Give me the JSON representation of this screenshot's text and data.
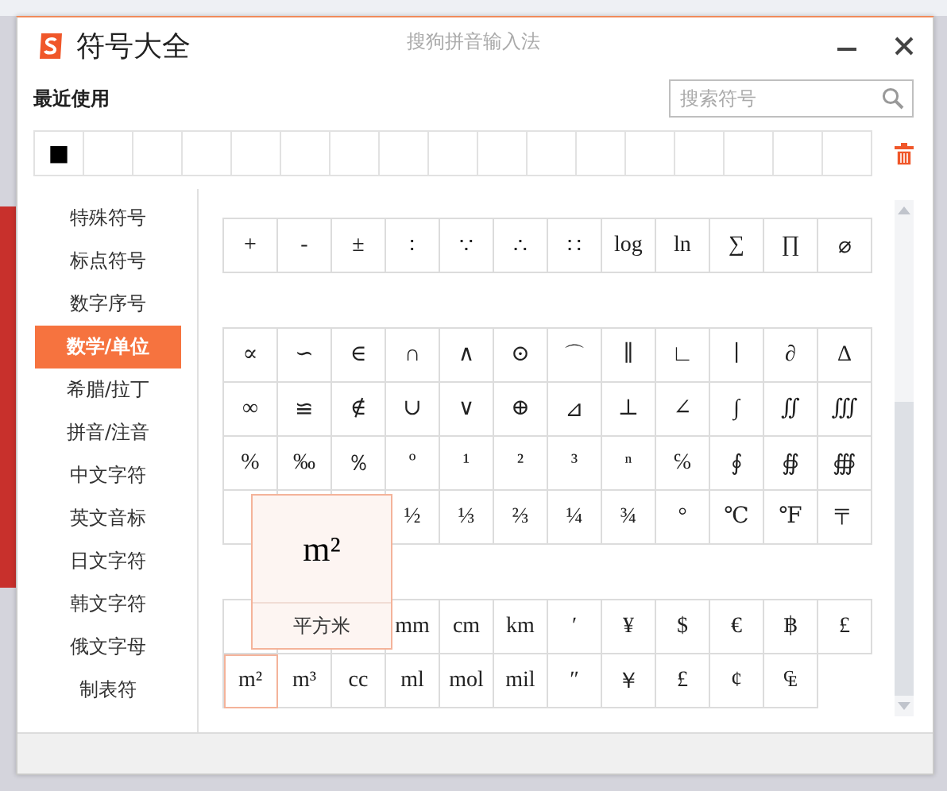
{
  "window": {
    "title": "符号大全",
    "app_name": "搜狗拼音输入法"
  },
  "recent": {
    "label": "最近使用",
    "symbols": [
      "■"
    ]
  },
  "search": {
    "placeholder": "搜索符号"
  },
  "categories": [
    {
      "label": "特殊符号",
      "selected": false
    },
    {
      "label": "标点符号",
      "selected": false
    },
    {
      "label": "数字序号",
      "selected": false
    },
    {
      "label": "数学/单位",
      "selected": true
    },
    {
      "label": "希腊/拉丁",
      "selected": false
    },
    {
      "label": "拼音/注音",
      "selected": false
    },
    {
      "label": "中文字符",
      "selected": false
    },
    {
      "label": "英文音标",
      "selected": false
    },
    {
      "label": "日文字符",
      "selected": false
    },
    {
      "label": "韩文字符",
      "selected": false
    },
    {
      "label": "俄文字母",
      "selected": false
    },
    {
      "label": "制表符",
      "selected": false
    }
  ],
  "sections": [
    {
      "rows": [
        [
          {
            "symbol": "+",
            "selected": false
          },
          {
            "symbol": "-",
            "selected": false
          },
          {
            "symbol": "±",
            "selected": false
          },
          {
            "symbol": "∶",
            "selected": false
          },
          {
            "symbol": "∵",
            "selected": false
          },
          {
            "symbol": "∴",
            "selected": false
          },
          {
            "symbol": "∷",
            "selected": false
          },
          {
            "symbol": "log",
            "selected": false
          },
          {
            "symbol": "ln",
            "selected": false
          },
          {
            "symbol": "∑",
            "selected": false
          },
          {
            "symbol": "∏",
            "selected": false
          },
          {
            "symbol": "⌀",
            "selected": false
          }
        ]
      ]
    },
    {
      "rows": [
        [
          {
            "symbol": "∝",
            "selected": false
          },
          {
            "symbol": "∽",
            "selected": false
          },
          {
            "symbol": "∈",
            "selected": false
          },
          {
            "symbol": "∩",
            "selected": false
          },
          {
            "symbol": "∧",
            "selected": false
          },
          {
            "symbol": "⊙",
            "selected": false
          },
          {
            "symbol": "⌒",
            "selected": false
          },
          {
            "symbol": "∥",
            "selected": false
          },
          {
            "symbol": "∟",
            "selected": false
          },
          {
            "symbol": "∣",
            "selected": false
          },
          {
            "symbol": "∂",
            "selected": false
          },
          {
            "symbol": "Δ",
            "selected": false
          }
        ],
        [
          {
            "symbol": "∞",
            "selected": false
          },
          {
            "symbol": "≌",
            "selected": false
          },
          {
            "symbol": "∉",
            "selected": false
          },
          {
            "symbol": "∪",
            "selected": false
          },
          {
            "symbol": "∨",
            "selected": false
          },
          {
            "symbol": "⊕",
            "selected": false
          },
          {
            "symbol": "⊿",
            "selected": false
          },
          {
            "symbol": "⊥",
            "selected": false
          },
          {
            "symbol": "∠",
            "selected": false
          },
          {
            "symbol": "∫",
            "selected": false
          },
          {
            "symbol": "∬",
            "selected": false
          },
          {
            "symbol": "∭",
            "selected": false
          }
        ],
        [
          {
            "symbol": "%",
            "selected": false
          },
          {
            "symbol": "‰",
            "selected": false
          },
          {
            "symbol": "％",
            "selected": false
          },
          {
            "symbol": "º",
            "selected": false
          },
          {
            "symbol": "¹",
            "selected": false
          },
          {
            "symbol": "²",
            "selected": false
          },
          {
            "symbol": "³",
            "selected": false
          },
          {
            "symbol": "ⁿ",
            "selected": false
          },
          {
            "symbol": "℅",
            "selected": false
          },
          {
            "symbol": "∮",
            "selected": false
          },
          {
            "symbol": "∯",
            "selected": false
          },
          {
            "symbol": "∰",
            "selected": false
          }
        ],
        [
          null,
          null,
          null,
          {
            "symbol": "½",
            "selected": false
          },
          {
            "symbol": "⅓",
            "selected": false
          },
          {
            "symbol": "⅔",
            "selected": false
          },
          {
            "symbol": "¼",
            "selected": false
          },
          {
            "symbol": "¾",
            "selected": false
          },
          {
            "symbol": "°",
            "selected": false
          },
          {
            "symbol": "℃",
            "selected": false
          },
          {
            "symbol": "℉",
            "selected": false
          },
          {
            "symbol": "〒",
            "selected": false
          }
        ]
      ]
    },
    {
      "rows": [
        [
          null,
          null,
          null,
          {
            "symbol": "mm",
            "selected": false
          },
          {
            "symbol": "cm",
            "selected": false
          },
          {
            "symbol": "km",
            "selected": false
          },
          {
            "symbol": "′",
            "selected": false
          },
          {
            "symbol": "¥",
            "selected": false
          },
          {
            "symbol": "$",
            "selected": false
          },
          {
            "symbol": "€",
            "selected": false
          },
          {
            "symbol": "฿",
            "selected": false
          },
          {
            "symbol": "£",
            "selected": false
          }
        ],
        [
          {
            "symbol": "m²",
            "selected": true
          },
          {
            "symbol": "m³",
            "selected": false
          },
          {
            "symbol": "cc",
            "selected": false
          },
          {
            "symbol": "ml",
            "selected": false
          },
          {
            "symbol": "mol",
            "selected": false
          },
          {
            "symbol": "mil",
            "selected": false
          },
          {
            "symbol": "″",
            "selected": false
          },
          {
            "symbol": "￥",
            "selected": false
          },
          {
            "symbol": "£",
            "selected": false
          },
          {
            "symbol": "¢",
            "selected": false
          },
          {
            "symbol": "₠",
            "selected": false
          }
        ]
      ]
    }
  ],
  "tooltip": {
    "symbol": "m²",
    "name": "平方米"
  }
}
